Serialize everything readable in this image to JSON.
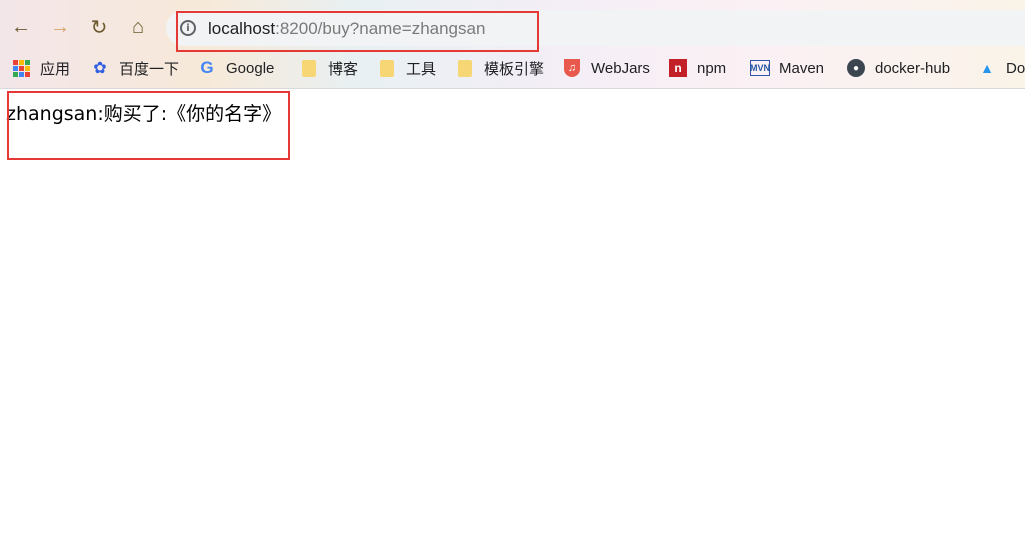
{
  "address_bar": {
    "host": "localhost",
    "rest": ":8200/buy?name=zhangsan"
  },
  "bookmarks": [
    {
      "label": "应用",
      "icon": "apps-grid-icon"
    },
    {
      "label": "百度一下",
      "icon": "baidu-paw-icon"
    },
    {
      "label": "Google",
      "icon": "google-icon"
    },
    {
      "label": "博客",
      "icon": "folder-icon"
    },
    {
      "label": "工具",
      "icon": "folder-icon"
    },
    {
      "label": "模板引擎",
      "icon": "folder-icon"
    },
    {
      "label": "WebJars",
      "icon": "webjars-icon"
    },
    {
      "label": "npm",
      "icon": "npm-icon"
    },
    {
      "label": "Maven",
      "icon": "maven-icon"
    },
    {
      "label": "docker-hub",
      "icon": "docker-icon"
    },
    {
      "label": "Do",
      "icon": "docker-whale-icon"
    }
  ],
  "page": {
    "message": "zhangsan:购买了:《你的名字》"
  },
  "colors": {
    "highlight": "#e53935",
    "omnibox_bg": "#f1f3f4"
  }
}
